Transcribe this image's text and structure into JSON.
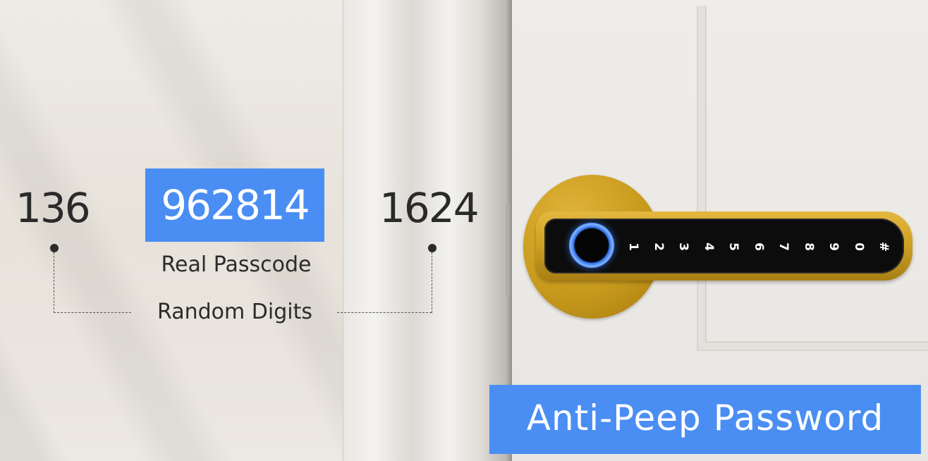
{
  "left_number": "136",
  "real_passcode": "962814",
  "right_number": "1624",
  "real_label": "Real Passcode",
  "random_label": "Random Digits",
  "keypad_keys": [
    "1",
    "2",
    "3",
    "4",
    "5",
    "6",
    "7",
    "8",
    "9",
    "0",
    "#"
  ],
  "tagline": "Anti-Peep Password",
  "colors": {
    "accent_blue": "#4a8ef3",
    "lock_gold": "#cc9e22",
    "keypad_black": "#0c0c0c",
    "fingerprint_glow": "#2e6fe8"
  }
}
